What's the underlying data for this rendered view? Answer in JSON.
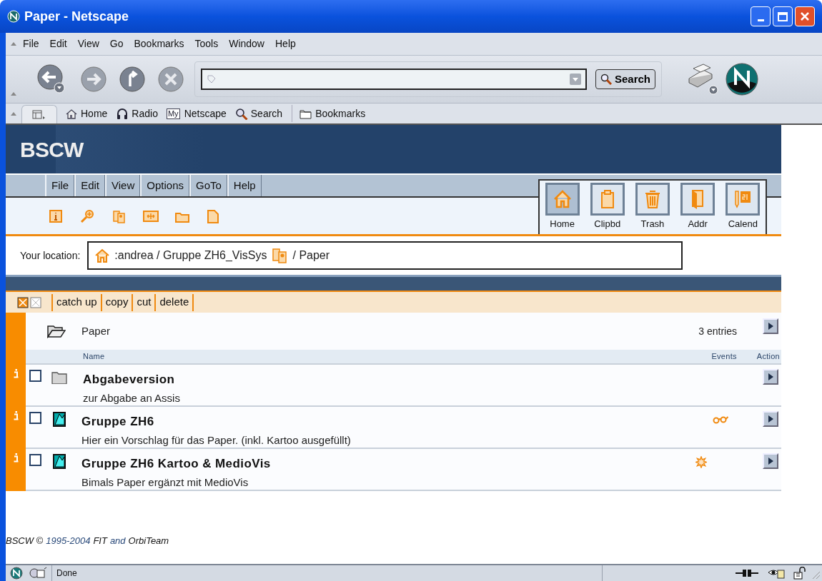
{
  "window": {
    "title": "Paper - Netscape"
  },
  "browser_menu": [
    "File",
    "Edit",
    "View",
    "Go",
    "Bookmarks",
    "Tools",
    "Window",
    "Help"
  ],
  "navigation": {
    "search_button": "Search"
  },
  "personal_toolbar": [
    {
      "label": "Home",
      "kind": "home"
    },
    {
      "label": "Radio",
      "kind": "radio"
    },
    {
      "label": "Netscape",
      "kind": "my",
      "badge": "My"
    },
    {
      "label": "Search",
      "kind": "search"
    },
    {
      "label": "Bookmarks",
      "kind": "bookmarks"
    }
  ],
  "bscw": {
    "logo": "BSCW",
    "menu": [
      "File",
      "Edit",
      "View",
      "Options",
      "GoTo",
      "Help"
    ],
    "tools": [
      {
        "label": "Home",
        "kind": "home",
        "selected": true
      },
      {
        "label": "Clipbd",
        "kind": "clipboard",
        "selected": false
      },
      {
        "label": "Trash",
        "kind": "trash",
        "selected": false
      },
      {
        "label": "Addr",
        "kind": "address",
        "selected": false
      },
      {
        "label": "Calend",
        "kind": "calendar",
        "selected": false
      }
    ],
    "location": {
      "label": "Your location:",
      "path": [
        {
          "kind": "home"
        },
        {
          "kind": "text",
          "text": ":andrea / Gruppe ZH6_VisSys"
        },
        {
          "kind": "group"
        },
        {
          "kind": "text",
          "text": "/ Paper"
        }
      ]
    },
    "actions": [
      "catch up",
      "copy",
      "cut",
      "delete"
    ],
    "folder": {
      "name": "Paper",
      "count": "3 entries"
    },
    "columns": [
      "Name",
      "Events",
      "Action"
    ],
    "rows": [
      {
        "kind": "folder",
        "title": "Abgabeversion",
        "description": "zur Abgabe an Assis",
        "checked": false
      },
      {
        "kind": "document",
        "title": "Gruppe ZH6",
        "description": "Hier ein Vorschlag für das Paper. (inkl. Kartoo ausgefüllt)",
        "checked": false,
        "events": [
          {
            "kind": "read"
          }
        ]
      },
      {
        "kind": "document",
        "title": "Gruppe ZH6 Kartoo & MedioVis",
        "description": "Bimals Paper ergänzt mit MedioVis",
        "checked": false,
        "events": [
          {
            "kind": "new"
          }
        ]
      }
    ],
    "footer": [
      {
        "text": "BSCW ©",
        "link": false
      },
      {
        "text": "1995-2004",
        "link": true
      },
      {
        "text": "FIT",
        "link": false
      },
      {
        "text": "and",
        "link": true
      },
      {
        "text": "OrbiTeam",
        "link": false
      }
    ]
  },
  "status_bar": {
    "text": "Done"
  }
}
